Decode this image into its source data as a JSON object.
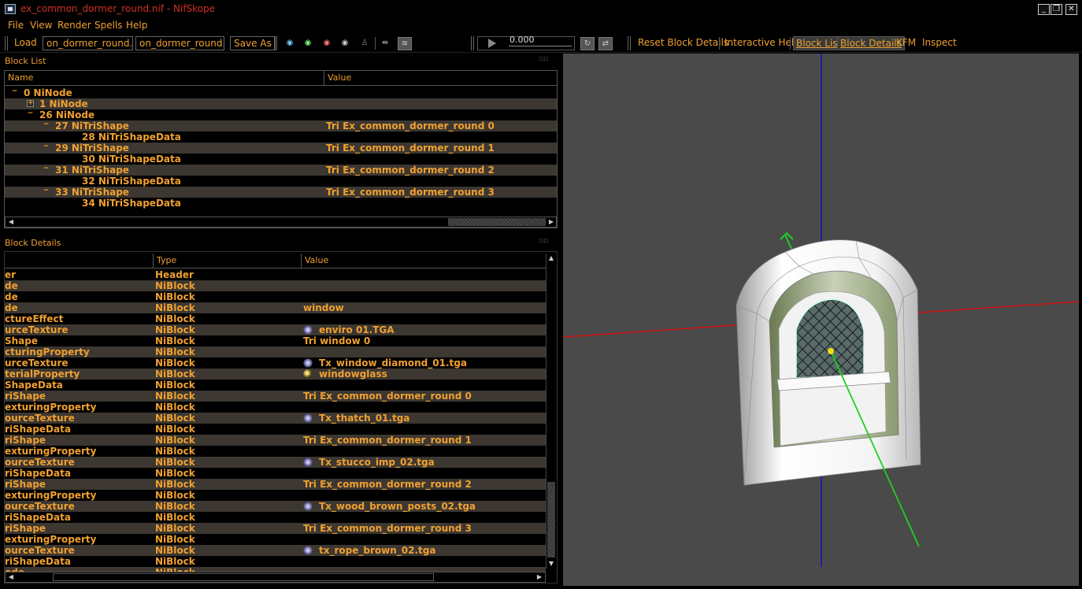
{
  "window": {
    "title": "ex_common_dormer_round.nif - NifSkope",
    "min": "_",
    "max": "❐",
    "close": "✕"
  },
  "menu": [
    "File",
    "View",
    "Render",
    "Spells",
    "Help"
  ],
  "toolbar": {
    "load": "Load",
    "load_file": "on_dormer_round.nif",
    "save_file": "on_dormer_round.nif",
    "save_as": "Save As",
    "time": "0.000",
    "reset_block_details": "Reset Block Details",
    "interactive_help": "Interactive Help",
    "block_list": "Block List",
    "block_details": "Block Details",
    "kfm": "KFM",
    "inspect": "Inspect"
  },
  "block_list": {
    "title": "Block List",
    "columns": [
      "Name",
      "Value"
    ],
    "rows": [
      {
        "exp": "−",
        "name": "0 NiNode",
        "value": ""
      },
      {
        "exp": "+",
        "name": "1 NiNode",
        "value": ""
      },
      {
        "exp": "−",
        "name": "26 NiNode",
        "value": ""
      },
      {
        "exp": "−",
        "name": "27 NiTriShape",
        "value": "Tri Ex_common_dormer_round 0"
      },
      {
        "exp": "",
        "name": "28 NiTriShapeData",
        "value": ""
      },
      {
        "exp": "−",
        "name": "29 NiTriShape",
        "value": "Tri Ex_common_dormer_round 1"
      },
      {
        "exp": "",
        "name": "30 NiTriShapeData",
        "value": ""
      },
      {
        "exp": "−",
        "name": "31 NiTriShape",
        "value": "Tri Ex_common_dormer_round 2"
      },
      {
        "exp": "",
        "name": "32 NiTriShapeData",
        "value": ""
      },
      {
        "exp": "−",
        "name": "33 NiTriShape",
        "value": "Tri Ex_common_dormer_round 3"
      },
      {
        "exp": "",
        "name": "34 NiTriShapeData",
        "value": ""
      }
    ]
  },
  "block_details": {
    "title": "Block Details",
    "columns": [
      "",
      "Type",
      "Value"
    ],
    "rows": [
      {
        "name": "er",
        "type": "Header",
        "value": "",
        "icon": ""
      },
      {
        "name": "de",
        "type": "NiBlock",
        "value": "",
        "icon": ""
      },
      {
        "name": "de",
        "type": "NiBlock",
        "value": "",
        "icon": ""
      },
      {
        "name": "de",
        "type": "NiBlock",
        "value": "window",
        "icon": ""
      },
      {
        "name": "ctureEffect",
        "type": "NiBlock",
        "value": "",
        "icon": ""
      },
      {
        "name": "urceTexture",
        "type": "NiBlock",
        "value": "enviro 01.TGA",
        "icon": "tex"
      },
      {
        "name": "Shape",
        "type": "NiBlock",
        "value": "Tri window 0",
        "icon": ""
      },
      {
        "name": "cturingProperty",
        "type": "NiBlock",
        "value": "",
        "icon": ""
      },
      {
        "name": "urceTexture",
        "type": "NiBlock",
        "value": "Tx_window_diamond_01.tga",
        "icon": "tex"
      },
      {
        "name": "terialProperty",
        "type": "NiBlock",
        "value": "windowglass",
        "icon": "mat"
      },
      {
        "name": "ShapeData",
        "type": "NiBlock",
        "value": "",
        "icon": ""
      },
      {
        "name": "riShape",
        "type": "NiBlock",
        "value": "Tri Ex_common_dormer_round 0",
        "icon": ""
      },
      {
        "name": "exturingProperty",
        "type": "NiBlock",
        "value": "",
        "icon": ""
      },
      {
        "name": "ourceTexture",
        "type": "NiBlock",
        "value": "Tx_thatch_01.tga",
        "icon": "tex"
      },
      {
        "name": "riShapeData",
        "type": "NiBlock",
        "value": "",
        "icon": ""
      },
      {
        "name": "riShape",
        "type": "NiBlock",
        "value": "Tri Ex_common_dormer_round 1",
        "icon": ""
      },
      {
        "name": "exturingProperty",
        "type": "NiBlock",
        "value": "",
        "icon": ""
      },
      {
        "name": "ourceTexture",
        "type": "NiBlock",
        "value": "Tx_stucco_imp_02.tga",
        "icon": "tex"
      },
      {
        "name": "riShapeData",
        "type": "NiBlock",
        "value": "",
        "icon": ""
      },
      {
        "name": "riShape",
        "type": "NiBlock",
        "value": "Tri Ex_common_dormer_round 2",
        "icon": ""
      },
      {
        "name": "exturingProperty",
        "type": "NiBlock",
        "value": "",
        "icon": ""
      },
      {
        "name": "ourceTexture",
        "type": "NiBlock",
        "value": "Tx_wood_brown_posts_02.tga",
        "icon": "tex"
      },
      {
        "name": "riShapeData",
        "type": "NiBlock",
        "value": "",
        "icon": ""
      },
      {
        "name": "riShape",
        "type": "NiBlock",
        "value": "Tri Ex_common_dormer_round 3",
        "icon": ""
      },
      {
        "name": "exturingProperty",
        "type": "NiBlock",
        "value": "",
        "icon": ""
      },
      {
        "name": "ourceTexture",
        "type": "NiBlock",
        "value": "tx_rope_brown_02.tga",
        "icon": "tex"
      },
      {
        "name": "riShapeData",
        "type": "NiBlock",
        "value": "",
        "icon": ""
      },
      {
        "name": "ode",
        "type": "NiBlock",
        "value": "",
        "icon": ""
      }
    ]
  },
  "colors": {
    "text": "#f0a030",
    "alt_row": "#3c3731",
    "viewport_bg": "#4a4a4a",
    "axis_x": "#d01010",
    "axis_y": "#10c010",
    "axis_z": "#1010c0"
  }
}
